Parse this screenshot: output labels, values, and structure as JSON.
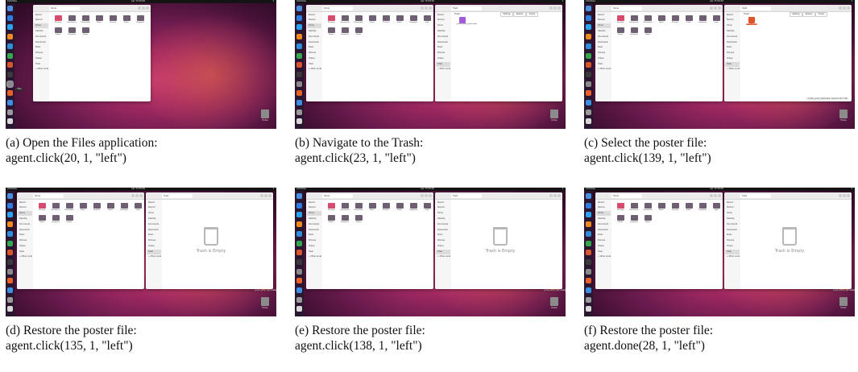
{
  "colors": {
    "wallpaper_dark": "#27091f",
    "wallpaper_mid": "#9c2860",
    "wallpaper_light": "#c23a6e",
    "dock": "#2a1630",
    "selection": "#e0542a",
    "folder": "#6e6072",
    "folder_highlight": "#d64b6e",
    "text_caption": "#111111"
  },
  "top_bar": {
    "activities": "Activities",
    "clock": "Apr 15 09:49"
  },
  "dock_icons": [
    {
      "name": "chrome-icon",
      "color": "#4a8fe0"
    },
    {
      "name": "thunderbird-icon",
      "color": "#2f7de1"
    },
    {
      "name": "vscode-icon",
      "color": "#2aa3f0"
    },
    {
      "name": "vlc-icon",
      "color": "#f08a1c"
    },
    {
      "name": "writer-icon",
      "color": "#2e8fd8"
    },
    {
      "name": "calc-icon",
      "color": "#35a84f"
    },
    {
      "name": "impress-icon",
      "color": "#d9552c"
    },
    {
      "name": "terminal-icon",
      "color": "#3a3a3a"
    },
    {
      "name": "files-icon",
      "color": "#8a8a8a"
    },
    {
      "name": "software-icon",
      "color": "#e9622c"
    },
    {
      "name": "help-icon",
      "color": "#3c8fe0"
    },
    {
      "name": "trash-icon",
      "color": "#9a9a9a"
    },
    {
      "name": "apps-grid-icon",
      "color": "#d8d8d8"
    }
  ],
  "files_window": {
    "path_label": "Home",
    "sidebar": [
      "Recent",
      "Starred",
      "Home",
      "Desktop",
      "Documents",
      "Downloads",
      "Music",
      "Pictures",
      "Videos",
      "Trash",
      "+ Other Locations"
    ],
    "home_folders": [
      "Desktop",
      "Documents",
      "Downloads",
      "Music",
      "Pictures",
      "Public",
      "Templates",
      "snap",
      "Videos",
      "Templates",
      "Videos"
    ]
  },
  "trash_window": {
    "path_label": "Trash",
    "title": "Trash",
    "settings_button": "Settings",
    "restore_button": "Restore",
    "empty_button": "Empty",
    "file_label": "poster_party_night.webp",
    "empty_text": "Trash is Empty",
    "status_text": "\"poster_party_night.webp\" selected (51.7 kB)"
  },
  "desktop": {
    "trash_label": "Home",
    "restored_file_label": "poster_party_night.webp"
  },
  "tooltip": "Files",
  "panels": [
    {
      "id": "a",
      "caption_line1": "(a) Open the Files application:",
      "caption_line2": "agent.click(20, 1, \"left\")",
      "state": "files"
    },
    {
      "id": "b",
      "caption_line1": "(b) Navigate to the Trash:",
      "caption_line2": "agent.click(23, 1, \"left\")",
      "state": "trash"
    },
    {
      "id": "c",
      "caption_line1": "(c) Select the poster file:",
      "caption_line2": "agent.click(139, 1, \"left\")",
      "state": "selected"
    },
    {
      "id": "d",
      "caption_line1": "(d) Restore the poster file:",
      "caption_line2": "agent.click(135, 1, \"left\")",
      "state": "empty"
    },
    {
      "id": "e",
      "caption_line1": "(e) Restore the poster file:",
      "caption_line2": "agent.click(138, 1, \"left\")",
      "state": "empty"
    },
    {
      "id": "f",
      "caption_line1": "(f) Restore the poster file:",
      "caption_line2": "agent.done(28, 1, \"left\")",
      "state": "empty-desktop"
    }
  ]
}
